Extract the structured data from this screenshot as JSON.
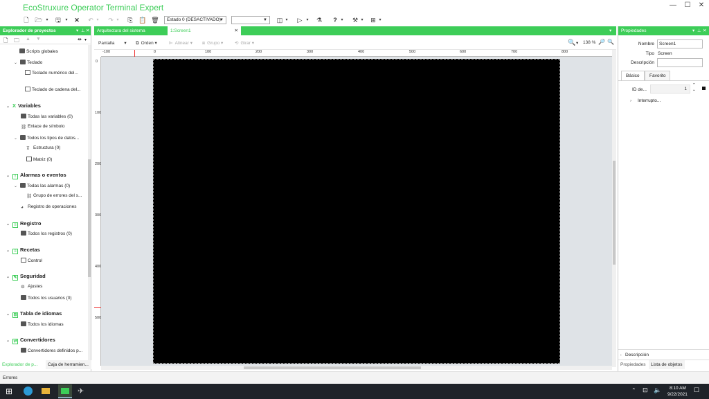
{
  "app": {
    "title": "EcoStruxure Operator Terminal Expert",
    "window_controls": {
      "minimize": "—",
      "maximize": "☐",
      "close": "✕"
    }
  },
  "toolbar": {
    "state_select": "Estado 0 (DESACTIVADO)",
    "empty_select": ""
  },
  "left_panel": {
    "title": "Explorador de proyectos",
    "tree": {
      "scripts_globales": "Scripts globales",
      "teclado": "Teclado",
      "teclado_numerico": "Teclado numérico del...",
      "teclado_cadena": "Teclado de cadena del...",
      "variables": "Variables",
      "todas_variables": "Todas las variables (0)",
      "enlace_simbolo": "Enlace de símbolo",
      "tipos_datos": "Todos los tipos de datos...",
      "estructura": "Estructura (0)",
      "matriz": "Matriz (0)",
      "alarmas": "Alarmas o eventos",
      "todas_alarmas": "Todas las alarmas (0)",
      "grupo_errores": "Grupo de errores del s...",
      "registro_operaciones": "Registro de operaciones",
      "registro": "Registro",
      "todos_registros": "Todos los registros (0)",
      "recetas": "Recetas",
      "control": "Control",
      "seguridad": "Seguridad",
      "ajustes": "Ajustes",
      "todos_usuarios": "Todos los usuarios (0)",
      "tabla_idiomas": "Tabla de idiomas",
      "todos_idiomas": "Todos los idiomas",
      "convertidores": "Convertidores",
      "convertidores_definidos": "Convertidores definidos p..."
    },
    "tabs": {
      "explorer": "Explorador de p...",
      "toolbox": "Caja de herramien..."
    }
  },
  "editor": {
    "tabs": {
      "architecture": "Arquitectura del sistema",
      "screen": "1:Screen1"
    },
    "tools": {
      "pantalla": "Pantalla",
      "orden": "Orden",
      "alinear": "Alinear",
      "grupo": "Grupo",
      "girar": "Girar",
      "zoom": "138 %"
    },
    "hruler_labels": [
      "-100",
      "0",
      "100",
      "200",
      "300",
      "400",
      "500",
      "600",
      "700",
      "800"
    ],
    "vruler_labels": [
      "0",
      "100",
      "200",
      "300",
      "400",
      "500"
    ]
  },
  "properties": {
    "title": "Propiedades",
    "nombre_label": "Nombre",
    "nombre_value": "Screen1",
    "tipo_label": "Tipo",
    "tipo_value": "Screen",
    "descripcion_label": "Descripción",
    "descripcion_value": "",
    "tabs": {
      "basic": "Básico",
      "favorite": "Favorito"
    },
    "id_label": "ID de...",
    "id_value": "1",
    "interruptor": "Interrupto...",
    "footer_descripcion": "Descripción",
    "bottom_tabs": {
      "properties": "Propiedades",
      "objects": "Lista de objetos"
    }
  },
  "status": {
    "errors": "Errores"
  },
  "taskbar": {
    "time": "8:10 AM",
    "date": "9/22/2021"
  },
  "colors": {
    "accent": "#3dcd58",
    "canvas": "#000000",
    "taskbar": "#1f2329"
  }
}
